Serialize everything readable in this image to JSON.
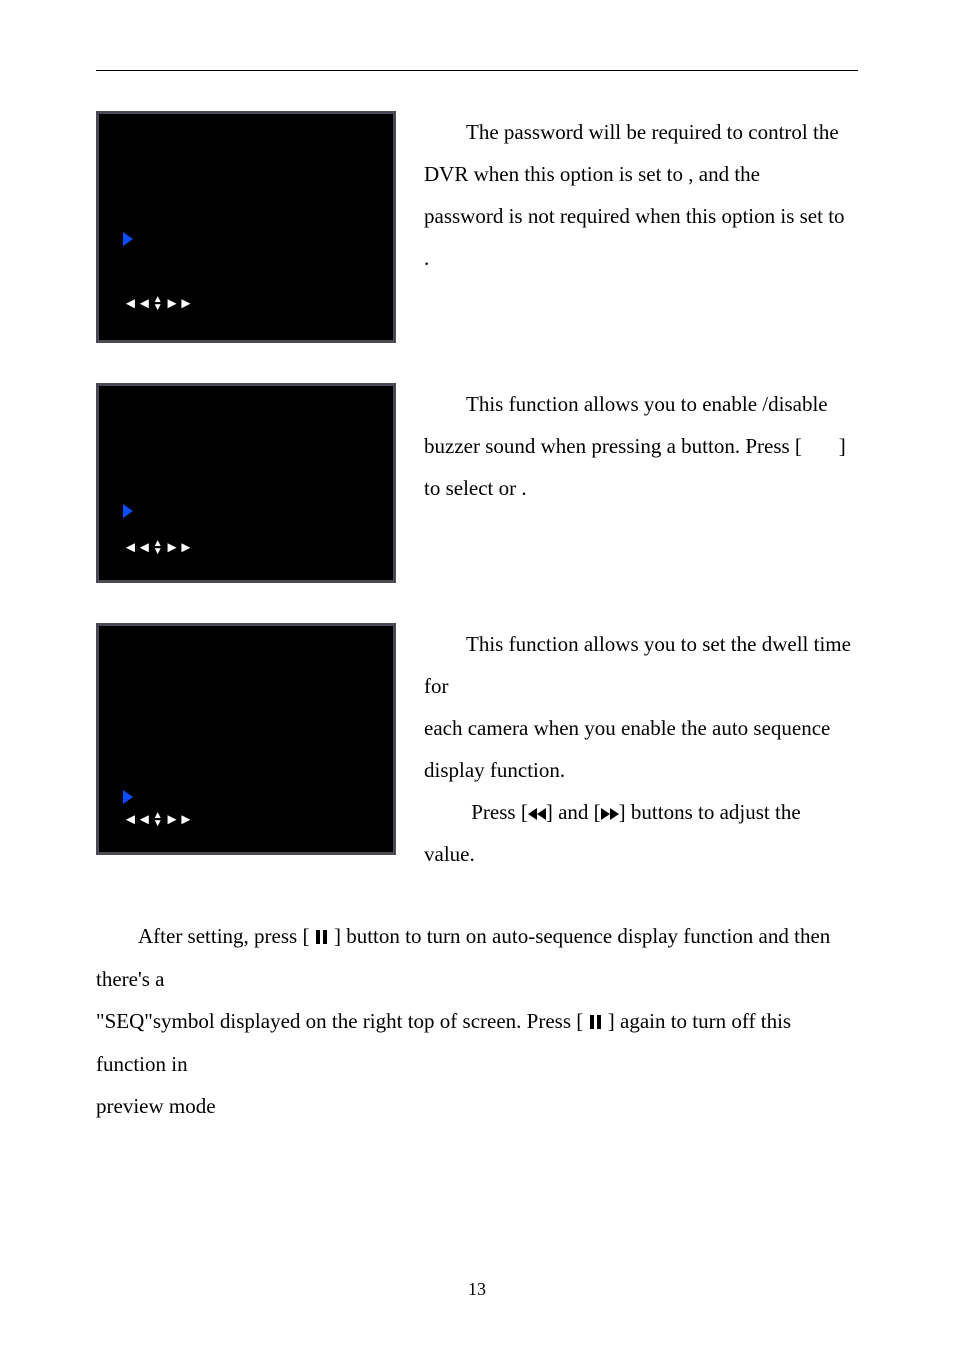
{
  "section1": {
    "p1a": "The password will be required to control the",
    "p1b": "DVR when this option is set to        , and the",
    "p1c": "password is not required when this option is set to",
    "p1d": "       ."
  },
  "section2": {
    "p1a": "This function allows you to enable /disable",
    "p1b_pre": "buzzer sound when pressing a button. Press [",
    "p1b_post": "]",
    "p1c": "to select       or        ."
  },
  "section3": {
    "p1a": "This function allows you to set the dwell time for",
    "p1b": "each camera when you enable the auto sequence",
    "p1c": "display function.",
    "p2a_pre": "Press [",
    "p2a_mid": "] and [",
    "p2a_post": "] buttons to adjust the",
    "p2b": "value."
  },
  "bottom": {
    "l1_pre": "After setting, press [ ",
    "l1_post": " ] button to turn on auto-sequence display function and then there's a",
    "l2_pre": "\"SEQ\"symbol displayed on the right top of screen. Press [ ",
    "l2_post": " ] again to turn off this function in",
    "l3": "preview mode"
  },
  "page_number": "13"
}
